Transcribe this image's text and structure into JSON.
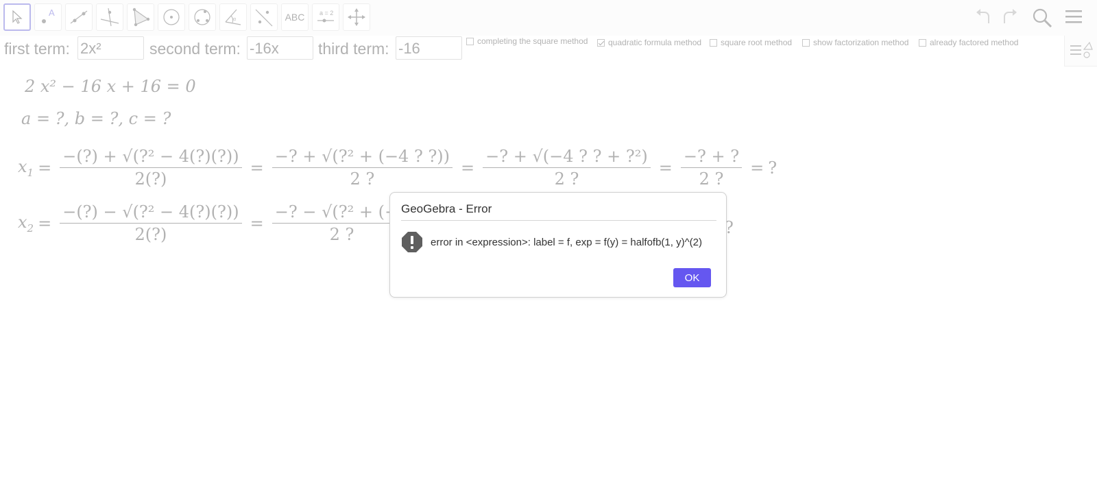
{
  "toolbar": {
    "tools": [
      {
        "name": "move-tool",
        "icon": "arrow-cursor-icon",
        "selected": true
      },
      {
        "name": "point-tool",
        "icon": "point-icon",
        "label": "A"
      },
      {
        "name": "line-tool",
        "icon": "line-icon"
      },
      {
        "name": "perpendicular-tool",
        "icon": "perpendicular-line-icon"
      },
      {
        "name": "polygon-tool",
        "icon": "polygon-icon"
      },
      {
        "name": "circle-center-tool",
        "icon": "circle-center-icon"
      },
      {
        "name": "circle-three-points-tool",
        "icon": "circle-three-points-icon"
      },
      {
        "name": "angle-tool",
        "icon": "angle-icon"
      },
      {
        "name": "reflect-tool",
        "icon": "reflect-line-icon"
      },
      {
        "name": "text-tool",
        "icon": "text-icon",
        "label": "ABC"
      },
      {
        "name": "slider-tool",
        "icon": "slider-icon",
        "label": "a = 2"
      },
      {
        "name": "move-graphics-tool",
        "icon": "move-view-icon"
      }
    ],
    "right": [
      "undo-icon",
      "redo-icon",
      "search-icon",
      "menu-icon"
    ]
  },
  "inputs": {
    "first_label": "first term:",
    "first_value": "2x²",
    "second_label": "second term:",
    "second_value": "-16x",
    "third_label": "third term:",
    "third_value": "-16"
  },
  "checkboxes": [
    {
      "label": "completing the square method",
      "checked": false
    },
    {
      "label": "quadratic formula method",
      "checked": true
    },
    {
      "label": "square root method",
      "checked": false
    },
    {
      "label": "show factorization method",
      "checked": false
    },
    {
      "label": "already factored method",
      "checked": false
    }
  ],
  "math": {
    "equation": "2 x² − 16 x + 16 = 0",
    "coefficients": "a = ?, b = ?, c = ?",
    "x1": {
      "var": "x",
      "sub": "1",
      "f1_num": "−(?) + √(?² − 4(?)(?))",
      "f1_den": "2(?)",
      "f2_num": "−? + √(?² + (−4 ? ?))",
      "f2_den": "2 ?",
      "f3_num": "−? + √(−4 ? ? + ?²)",
      "f3_den": "2 ?",
      "f4_num": "−? + ?",
      "f4_den": "2 ?",
      "result": "?"
    },
    "x2": {
      "var": "x",
      "sub": "2",
      "f1_num": "−(?) − √(?² − 4(?)(?))",
      "f1_den": "2(?)",
      "f2_num": "−? − √(?² + (−4",
      "f2_den": "2 ?",
      "result": "?"
    }
  },
  "dialog": {
    "title": "GeoGebra - Error",
    "message": "error in <expression>: label = f, exp = f(y) = halfofb(1, y)^(2)",
    "ok_label": "OK",
    "icon": "error-icon"
  },
  "colors": {
    "accent": "#6557f0",
    "selected_tool_border": "#6a66d8"
  }
}
